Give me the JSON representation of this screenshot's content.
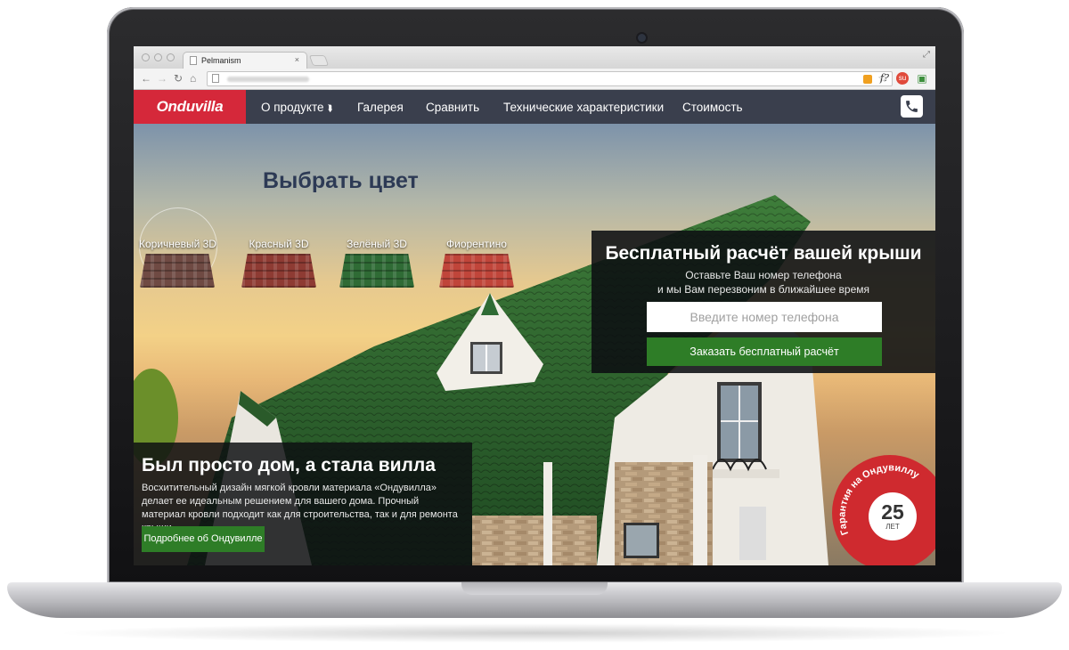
{
  "browser": {
    "tab_title": "Pelmanism",
    "tab_close": "×"
  },
  "site": {
    "logo": "Onduvilla",
    "nav": [
      {
        "label": "О продукте"
      },
      {
        "label": "Галерея"
      },
      {
        "label": "Сравнить"
      },
      {
        "label": "Технические характеристики"
      },
      {
        "label": "Стоимость"
      }
    ]
  },
  "hero": {
    "color_title": "Выбрать цвет",
    "swatches": [
      {
        "label": "Коричневый 3D",
        "color": "#6f4a43"
      },
      {
        "label": "Красный 3D",
        "color": "#8e3b33"
      },
      {
        "label": "Зелёный 3D",
        "color": "#2f6b35"
      },
      {
        "label": "Фиорентино",
        "color": "#c0453a"
      }
    ]
  },
  "callback": {
    "title": "Бесплатный расчёт вашей крыши",
    "subtitle_line1": "Оставьте Ваш номер телефона",
    "subtitle_line2": "и мы Вам перезвоним в ближайшее время",
    "phone_placeholder": "Введите номер телефона",
    "button": "Заказать бесплатный расчёт"
  },
  "promo": {
    "title": "Был просто дом, а стала вилла",
    "text": "Восхитительный дизайн мягкой кровли материала «Ондувилла» делает ее идеальным решением для вашего дома. Прочный материал кровли подходит как для строительства, так и для ремонта крыши.",
    "button": "Подробнее об Ондувилле"
  },
  "badge": {
    "arc_text": "Гарантия на Ондувиллу",
    "years": "25",
    "unit": "ЛЕТ"
  },
  "colors": {
    "brand_red": "#d5283a",
    "header_bg": "#3a3f4d",
    "cta_green": "#2e7d27",
    "title_navy": "#2d3a55"
  },
  "icons": [
    "phone-icon",
    "chevron-down-icon",
    "back-icon",
    "forward-icon",
    "reload-icon",
    "home-icon",
    "star-icon"
  ]
}
